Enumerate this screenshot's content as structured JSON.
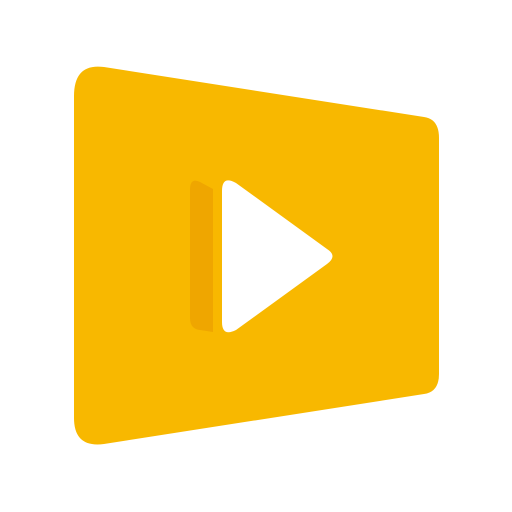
{
  "app_icon": {
    "icon_name": "video-player-icon",
    "colors": {
      "background": "#ffffff",
      "panel": "#F8B800",
      "play_shadow": "#EFA600",
      "play": "#ffffff"
    }
  }
}
